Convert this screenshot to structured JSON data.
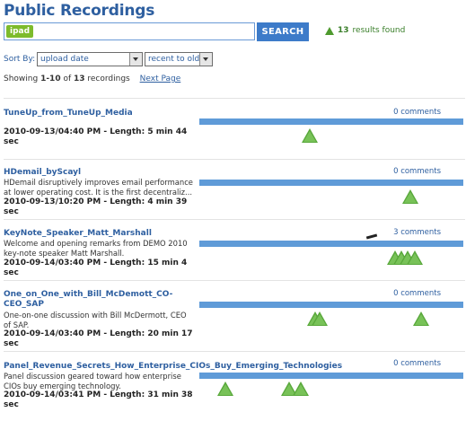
{
  "page": {
    "title": "Public Recordings"
  },
  "search": {
    "tag": "ipad",
    "button_label": "SEARCH",
    "results_count": "13",
    "results_suffix": "results found"
  },
  "sort": {
    "label": "Sort By:",
    "field": "upload date",
    "order": "recent to old"
  },
  "pagination": {
    "showing_prefix": "Showing ",
    "range": "1-10",
    "of": " of ",
    "total": "13",
    "suffix": " recordings",
    "next_label": "Next Page"
  },
  "recordings": [
    {
      "title": "TuneUp_from_TuneUp_Media",
      "description": "",
      "meta": "2010-09-13/04:40 PM - Length: 5 min 44 sec",
      "comments": "0 comments",
      "marker_positions": [
        0.42
      ]
    },
    {
      "title": "HDemail_byScayl",
      "description": "HDemail disruptively improves email performance at lower operating cost. It is the first decentraliz...",
      "meta": "2010-09-13/10:20 PM - Length: 4 min 39 sec",
      "comments": "0 comments",
      "marker_positions": [
        0.8
      ]
    },
    {
      "title": "KeyNote_Speaker_Matt_Marshall",
      "description": "Welcome and opening remarks from DEMO 2010 key-note speaker Matt Marshall.",
      "meta": "2010-09-14/03:40 PM - Length: 15 min 4 sec",
      "comments": "3 comments",
      "marker_positions": [
        0.74,
        0.765,
        0.79,
        0.815
      ]
    },
    {
      "title": "One_on_One_with_Bill_McDemott_CO-CEO_SAP",
      "description": "One-on-one discussion with Bill McDermott, CEO of SAP.",
      "meta": "2010-09-14/03:40 PM - Length: 20 min 17 sec",
      "comments": "0 comments",
      "marker_positions": [
        0.44,
        0.455,
        0.84
      ]
    },
    {
      "title": "Panel_Revenue_Secrets_How_Enterprise_CIOs_Buy_Emerging_Technologies",
      "description": "Panel discussion geared toward how enterprise CIOs buy emerging technology.",
      "meta": "2010-09-14/03:41 PM - Length: 31 min 38 sec",
      "comments": "0 comments",
      "marker_positions": [
        0.1,
        0.34,
        0.385
      ]
    }
  ],
  "colors": {
    "title_blue": "#2e5fa0",
    "bar_blue": "#5f9bd8",
    "marker_green": "#59a83b",
    "tag_green": "#7dbb2c"
  }
}
